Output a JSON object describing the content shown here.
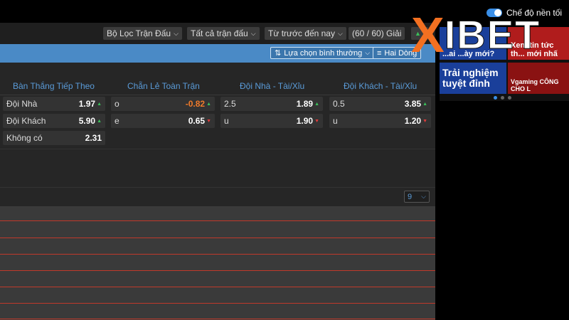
{
  "top": {
    "dark_mode_label": "Chế độ nền tối"
  },
  "filters": {
    "match_filter": "Bộ Lọc Trận Đấu",
    "all_matches": "Tất cả trận đấu",
    "time_from": "Từ trước đến nay",
    "league_count": "(60 / 60) Giải"
  },
  "toolbar": {
    "selection_mode": "Lựa chọn bình thường",
    "two_rows": "Hai Dòng"
  },
  "columns": [
    "Bàn Thắng Tiếp Theo",
    "Chẵn Lẻ Toàn Trận",
    "Đội Nhà - Tài/Xỉu",
    "Đội Khách - Tài/Xỉu"
  ],
  "next_goal": [
    {
      "label": "Đội Nhà",
      "odds": "1.97",
      "trend": "up"
    },
    {
      "label": "Đội Khách",
      "odds": "5.90",
      "trend": "up"
    },
    {
      "label": "Không có",
      "odds": "2.31",
      "trend": "none"
    }
  ],
  "odd_even": [
    {
      "label": "o",
      "odds": "-0.82",
      "trend": "up",
      "negative": true
    },
    {
      "label": "e",
      "odds": "0.65",
      "trend": "down",
      "negative": false
    }
  ],
  "home_ou": [
    {
      "label": "2.5",
      "odds": "1.89",
      "trend": "up"
    },
    {
      "label": "u",
      "odds": "1.90",
      "trend": "down"
    }
  ],
  "away_ou": [
    {
      "label": "0.5",
      "odds": "3.85",
      "trend": "up"
    },
    {
      "label": "u",
      "odds": "1.20",
      "trend": "down"
    }
  ],
  "pagination": {
    "page_size": "9"
  },
  "banner": {
    "tile1": "...ai ...ày mới?",
    "tile2": "Xem tin tức th... mới nhấ",
    "tile3": "Trải nghiệm tuyệt đỉnh",
    "tile4": "Vgaming  CÔNG CHO L"
  },
  "logo": {
    "x": "X",
    "text": "IBET"
  },
  "colors": {
    "accent_blue": "#4a8ac6",
    "header_text": "#5a9bd8",
    "logo_orange": "#f37021",
    "up": "#3bbf5a",
    "down": "#e03b3b",
    "negative_odds": "#f07a2a"
  }
}
